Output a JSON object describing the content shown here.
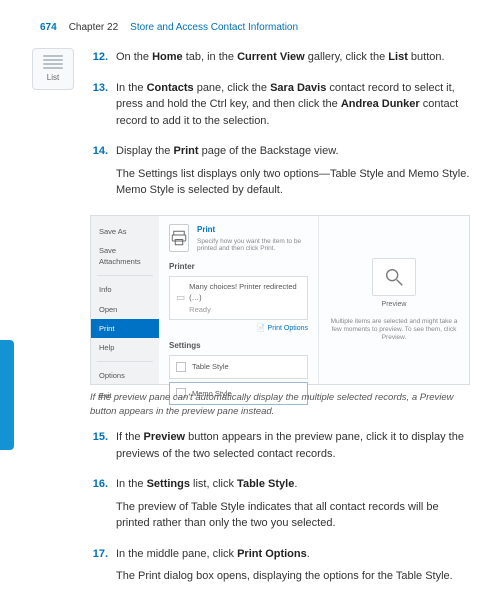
{
  "header": {
    "page": "674",
    "chapter": "Chapter 22",
    "title": "Store and Access Contact Information"
  },
  "icon": {
    "label": "List"
  },
  "steps": {
    "s12": {
      "num": "12.",
      "text": "On the Home tab, in the Current View gallery, click the List button.",
      "bold": {
        "home": "Home",
        "cv": "Current View",
        "list": "List"
      }
    },
    "s13": {
      "num": "13.",
      "text": "In the Contacts pane, click the Sara Davis contact record to select it, press and hold the Ctrl key, and then click the Andrea Dunker contact record to add it to the selection.",
      "bold": {
        "contacts": "Contacts",
        "sara": "Sara Davis",
        "andrea": "Andrea Dunker"
      }
    },
    "s14": {
      "num": "14.",
      "p1": "Display the Print page of the Backstage view.",
      "bold": {
        "print": "Print"
      },
      "p2": "The Settings list displays only two options—Table Style and Memo Style. Memo Style is selected by default."
    },
    "s15": {
      "num": "15.",
      "text": "If the Preview button appears in the preview pane, click it to display the previews of the two selected contact records.",
      "bold": {
        "preview": "Preview"
      }
    },
    "s16": {
      "num": "16.",
      "p1": "In the Settings list, click Table Style.",
      "bold": {
        "settings": "Settings",
        "ts": "Table Style"
      },
      "p2": "The preview of Table Style indicates that all contact records will be printed rather than only the two you selected."
    },
    "s17": {
      "num": "17.",
      "p1": "In the middle pane, click Print Options.",
      "bold": {
        "po": "Print Options"
      },
      "p2": "The Print dialog box opens, displaying the options for the Table Style."
    }
  },
  "figure": {
    "sidebar": {
      "saveas": "Save As",
      "saveatt": "Save Attachments",
      "info": "Info",
      "open": "Open",
      "print": "Print",
      "help": "Help",
      "options": "Options",
      "exit": "Exit"
    },
    "mid": {
      "print_title": "Print",
      "print_desc": "Specify how you want the item to be printed and then click Print.",
      "printer_h": "Printer",
      "printer_name": "Many choices! Printer redirected (…)",
      "printer_status": "Ready",
      "print_options": "Print Options",
      "settings_h": "Settings",
      "table_style": "Table Style",
      "memo_style": "Memo Style"
    },
    "preview": {
      "btn": "Preview",
      "note": "Multiple items are selected and might take a few moments to preview. To see them, click Preview."
    }
  },
  "figure_caption": "If the preview pane can't automatically display the multiple selected records, a Preview button appears in the preview pane instead."
}
